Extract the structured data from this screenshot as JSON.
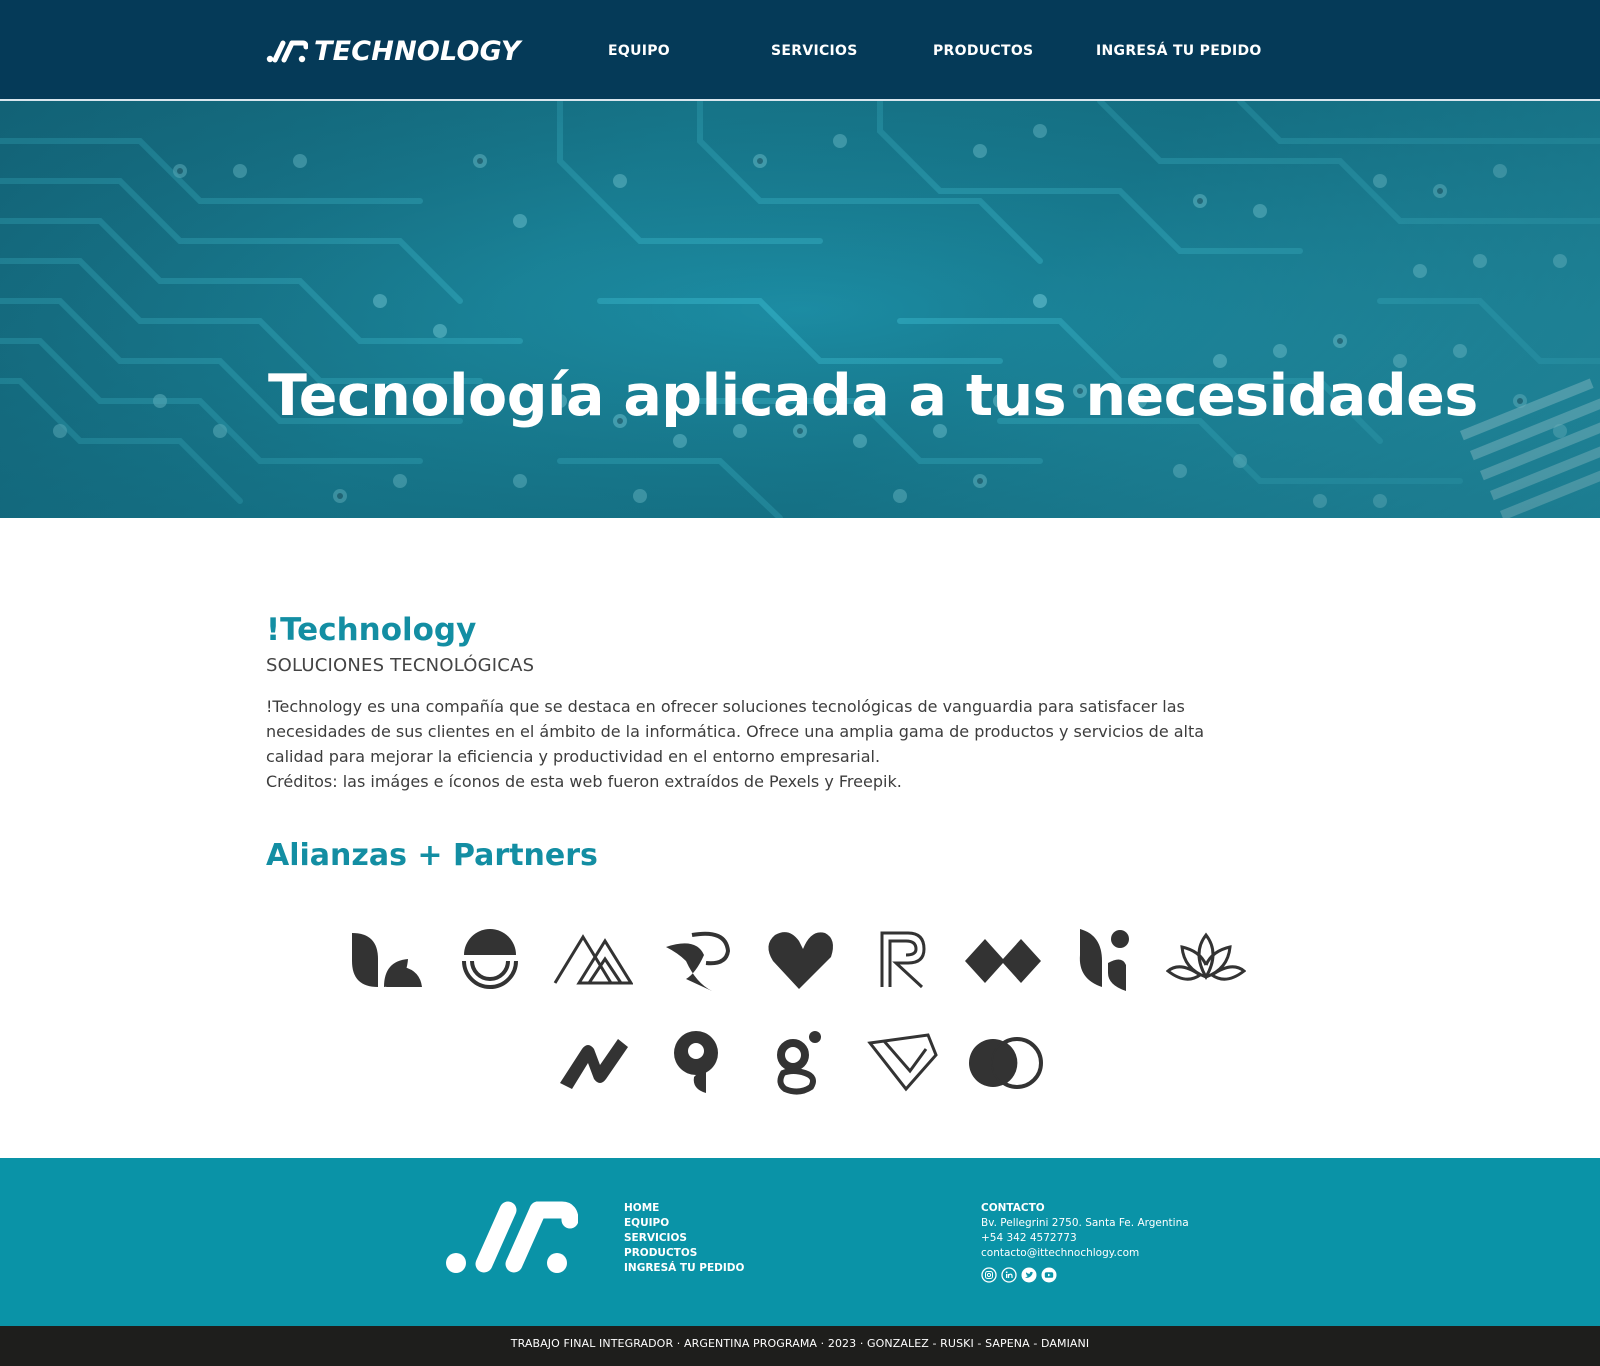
{
  "header": {
    "logo_text": "TECHNOLOGY",
    "nav": [
      "EQUIPO",
      "SERVICIOS",
      "PRODUCTOS",
      "INGRESÁ TU PEDIDO"
    ]
  },
  "hero": {
    "title": "Tecnología aplicada a tus necesidades"
  },
  "about": {
    "title": "!Technology",
    "subtitle": "SOLUCIONES TECNOLÓGICAS",
    "paragraph": "!Technology es una compañía que se destaca en ofrecer soluciones tecnológicas de vanguardia para satisfacer las necesidades de sus clientes en el ámbito de la informática. Ofrece una amplia gama de productos y servicios de alta calidad para mejorar la eficiencia y productividad en el entorno empresarial.",
    "credits": "Créditos: las imáges e íconos de esta web fueron extraídos de Pexels y Freepik."
  },
  "partners": {
    "title": "Alianzas + Partners",
    "logos": [
      "leaf-logo",
      "sun-logo",
      "mountains-logo",
      "bird-logo",
      "heart-logo",
      "r-logo",
      "diamonds-logo",
      "leaf-dot-logo",
      "lotus-logo",
      "n-logo",
      "nine-logo",
      "g-logo",
      "gem-logo",
      "circles-logo"
    ]
  },
  "footer": {
    "nav": [
      "HOME",
      "EQUIPO",
      "SERVICIOS",
      "PRODUCTOS",
      "INGRESÁ TU PEDIDO"
    ],
    "contact_title": "CONTACTO",
    "address": "Bv. Pellegrini 2750. Santa Fe. Argentina",
    "phone": "+54 342 4572773",
    "email": "contacto@ittechnochlogy.com",
    "socials": [
      "instagram-icon",
      "linkedin-icon",
      "twitter-icon",
      "youtube-icon"
    ],
    "bottom": "TRABAJO FINAL INTEGRADOR · ARGENTINA PROGRAMA · 2023 · GONZALEZ - RUSKI - SAPENA - DAMIANI"
  },
  "colors": {
    "header_bg": "#053a58",
    "accent": "#138ea3",
    "footer_bg": "#0a93a7",
    "bottom_bg": "#1e1e1c"
  }
}
